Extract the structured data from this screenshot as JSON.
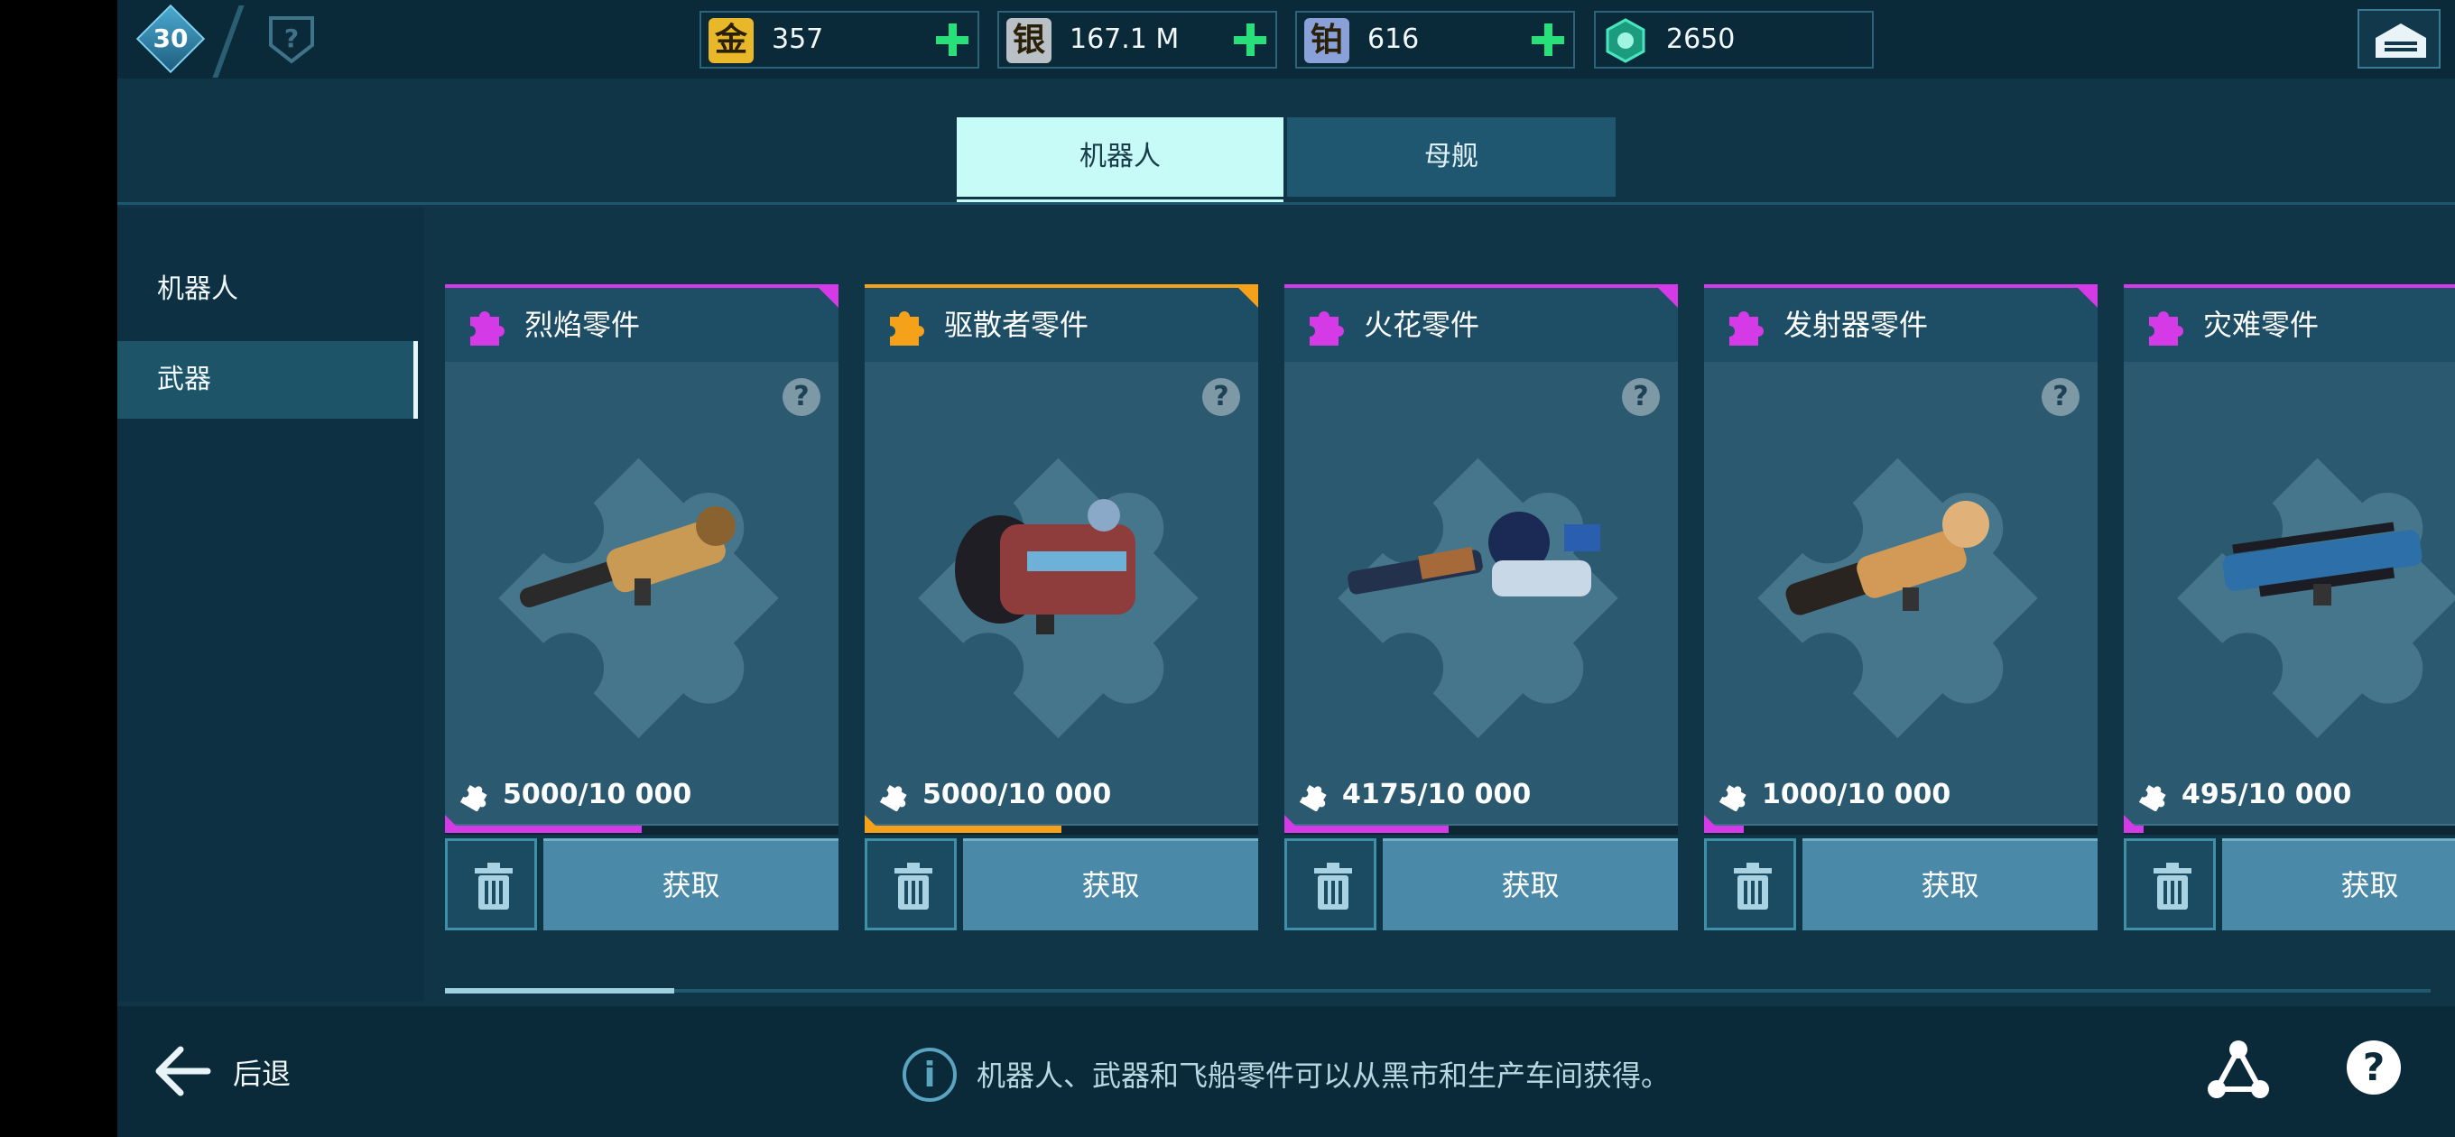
{
  "topbar": {
    "level": "30",
    "resources": [
      {
        "icon_char": "金",
        "value": "357",
        "icon": "gold-icon",
        "color": "#e8b72a",
        "has_plus": true
      },
      {
        "icon_char": "银",
        "value": "167.1 M",
        "icon": "silver-icon",
        "color": "#b9c0c6",
        "has_plus": true
      },
      {
        "icon_char": "铂",
        "value": "616",
        "icon": "platinum-icon",
        "color": "#8aa0d8",
        "has_plus": true
      },
      {
        "icon_char": "",
        "value": "2650",
        "icon": "key-token-icon",
        "color": "#2fd0a8",
        "has_plus": false
      }
    ]
  },
  "tabs": [
    {
      "label": "机器人",
      "active": true
    },
    {
      "label": "母舰",
      "active": false
    }
  ],
  "sidenav": {
    "items": [
      {
        "label": "机器人",
        "active": false
      },
      {
        "label": "武器",
        "active": true
      }
    ]
  },
  "cards": [
    {
      "name": "烈焰零件",
      "count": "5000/10 000",
      "progress": 0.5,
      "rarity_color": "#d43ae6",
      "button": "获取"
    },
    {
      "name": "驱散者零件",
      "count": "5000/10 000",
      "progress": 0.5,
      "rarity_color": "#f5a21a",
      "button": "获取"
    },
    {
      "name": "火花零件",
      "count": "4175/10 000",
      "progress": 0.4175,
      "rarity_color": "#d43ae6",
      "button": "获取"
    },
    {
      "name": "发射器零件",
      "count": "1000/10 000",
      "progress": 0.1,
      "rarity_color": "#d43ae6",
      "button": "获取"
    },
    {
      "name": "灾难零件",
      "count": "495/10 000",
      "progress": 0.0495,
      "rarity_color": "#d43ae6",
      "button": "获取"
    }
  ],
  "bottombar": {
    "back_label": "后退",
    "info_text": "机器人、武器和飞船零件可以从黑市和生产车间获得。"
  }
}
